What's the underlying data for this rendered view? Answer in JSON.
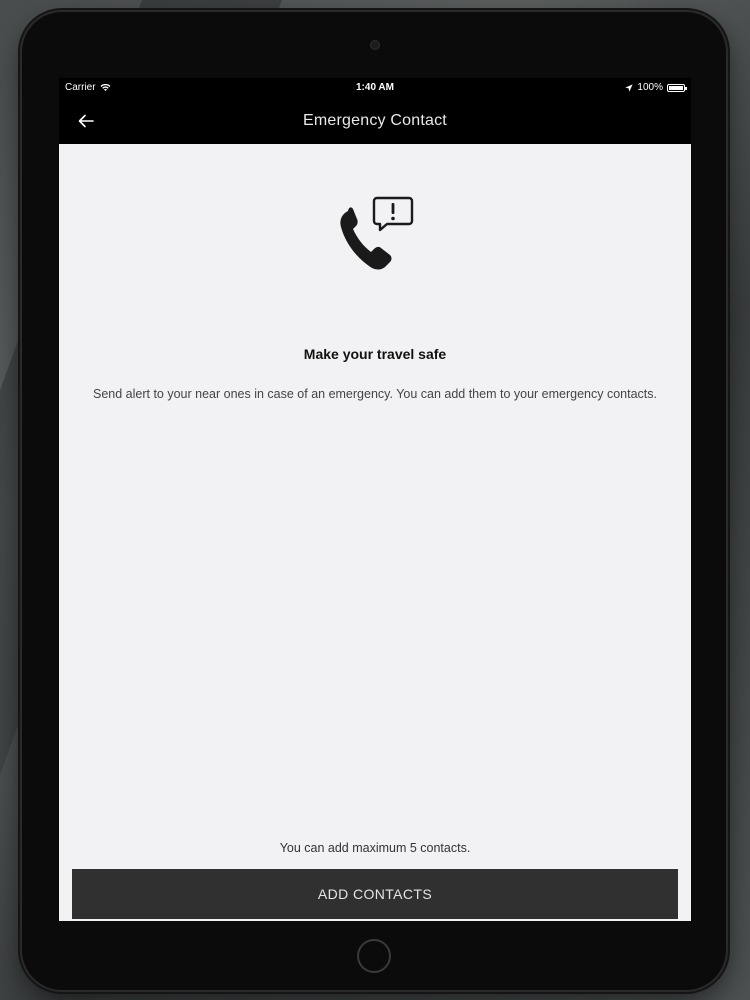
{
  "status_bar": {
    "carrier": "Carrier",
    "time": "1:40 AM",
    "battery": "100%"
  },
  "nav": {
    "title": "Emergency Contact",
    "back_icon": "arrow-left-icon"
  },
  "hero": {
    "icon": "phone-alert-icon"
  },
  "content": {
    "headline": "Make your travel safe",
    "description": "Send alert to your near ones in case of an emergency. You can add them to your emergency contacts."
  },
  "footer": {
    "max_note": "You can add maximum 5 contacts.",
    "add_button_label": "ADD CONTACTS"
  },
  "colors": {
    "status_bar_bg": "#000000",
    "screen_bg": "#f2f1f4",
    "button_bg": "#303030",
    "button_text": "#e4e4e4"
  }
}
